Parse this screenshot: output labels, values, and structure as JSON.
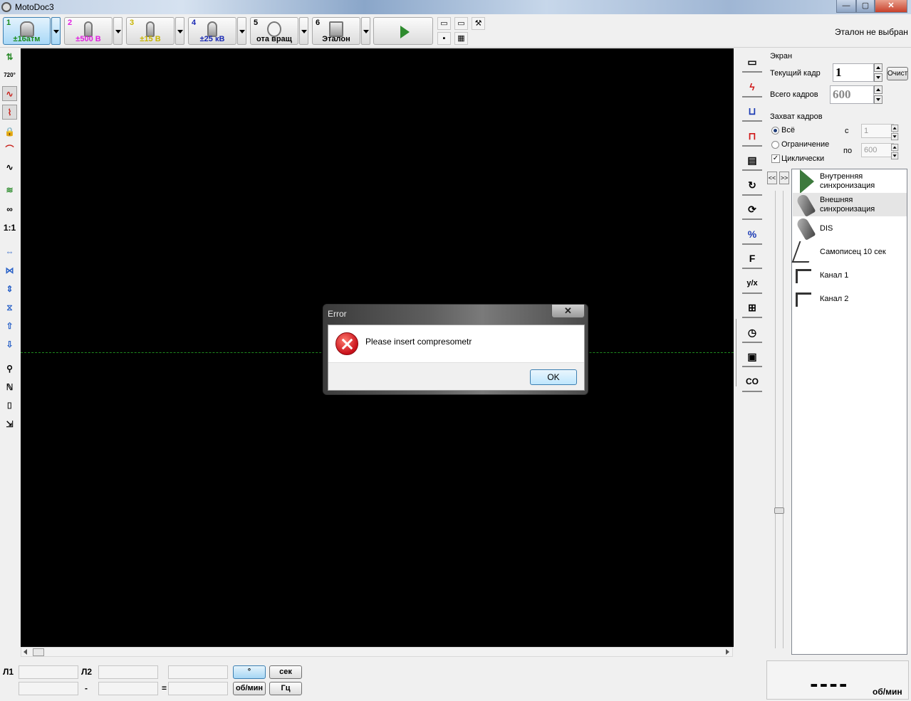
{
  "window": {
    "title": "MotoDoc3",
    "min": "—",
    "max": "▢",
    "close": "✕"
  },
  "toolbar": {
    "channels": [
      {
        "num": "1",
        "value": "±16атм",
        "num_color": "#1a8a1a",
        "value_color": "#1a8a1a"
      },
      {
        "num": "2",
        "value": "±500 В",
        "num_color": "#e020e0",
        "value_color": "#e020e0"
      },
      {
        "num": "3",
        "value": "±15 В",
        "num_color": "#c8b400",
        "value_color": "#c8b400"
      },
      {
        "num": "4",
        "value": "±25 кВ",
        "num_color": "#1a2ab4",
        "value_color": "#1a2ab4"
      },
      {
        "num": "5",
        "value": "ота вращ",
        "num_color": "#000000",
        "value_color": "#000000"
      },
      {
        "num": "6",
        "value": "Эталон",
        "num_color": "#000000",
        "value_color": "#000000"
      }
    ],
    "etalon_status": "Эталон не выбран",
    "small_icons": [
      "open-folder-icon",
      "open-file-icon",
      "wrench-icon",
      "save-icon",
      "export-icon"
    ]
  },
  "left_tools": [
    {
      "icon": "channels-icon",
      "glyph": "⇅"
    },
    {
      "icon": "720-icon",
      "glyph": "720°"
    },
    {
      "icon": "waveform-icon",
      "glyph": "∿"
    },
    {
      "icon": "trigger-icon",
      "glyph": "⌇"
    },
    {
      "icon": "lock-icon",
      "glyph": "🔒"
    },
    {
      "icon": "curve-icon",
      "glyph": "⌒"
    },
    {
      "icon": "sine-icon",
      "glyph": "∿"
    },
    {
      "icon": "multi-wave-icon",
      "glyph": "≋"
    },
    {
      "icon": "overlay-icon",
      "glyph": "∞"
    },
    {
      "icon": "scale-1-1-icon",
      "glyph": "1:1"
    },
    {
      "icon": "stretch-horizontal-icon",
      "glyph": "⇔"
    },
    {
      "icon": "shrink-horizontal-icon",
      "glyph": "⋈"
    },
    {
      "icon": "stretch-vertical-icon",
      "glyph": "⇕"
    },
    {
      "icon": "shrink-vertical-icon",
      "glyph": "⧖"
    },
    {
      "icon": "move-up-icon",
      "glyph": "⇧"
    },
    {
      "icon": "move-down-icon",
      "glyph": "⇩"
    },
    {
      "icon": "zoom-icon",
      "glyph": "⚲"
    },
    {
      "icon": "measure-icon",
      "glyph": "ℕ"
    },
    {
      "icon": "camera-icon",
      "glyph": "⌷"
    },
    {
      "icon": "export-icon",
      "glyph": "⇲"
    }
  ],
  "right_icons": [
    {
      "icon": "monitor-icon",
      "glyph": "▭"
    },
    {
      "icon": "spark-icon",
      "glyph": "ϟ"
    },
    {
      "icon": "pulse-blue-icon",
      "glyph": "⊔"
    },
    {
      "icon": "pulse-red-icon",
      "glyph": "⊓"
    },
    {
      "icon": "device-icon",
      "glyph": "▤"
    },
    {
      "icon": "rotation-icon",
      "glyph": "↻"
    },
    {
      "icon": "rotation-gear-icon",
      "glyph": "⟳"
    },
    {
      "icon": "percent-icon",
      "glyph": "%"
    },
    {
      "icon": "f-icon",
      "glyph": "F"
    },
    {
      "icon": "y-over-x-icon",
      "glyph": "y/x"
    },
    {
      "icon": "sensor-icon",
      "glyph": "⊞"
    },
    {
      "icon": "clock-icon",
      "glyph": "◷"
    },
    {
      "icon": "meter-icon",
      "glyph": "▣"
    },
    {
      "icon": "co-icon",
      "glyph": "CO"
    }
  ],
  "screen": {
    "group_title": "Экран",
    "current_frame_label": "Текущий кадр",
    "current_frame": "1",
    "total_frames_label": "Всего кадров",
    "total_frames": "600",
    "clear_label": "Очист"
  },
  "capture": {
    "group_title": "Захват кадров",
    "all_label": "Всё",
    "limit_label": "Ограничение",
    "cyclic_label": "Циклически",
    "from_label": "с",
    "from_value": "1",
    "to_label": "по",
    "to_value": "600",
    "nav_prev": "<<",
    "nav_next": ">>"
  },
  "sync_list": [
    {
      "label": "Внутренняя синхронизация",
      "icon": "play-sync-icon",
      "selected": false
    },
    {
      "label": "Внешняя синхронизация",
      "icon": "probe-icon",
      "selected": true
    },
    {
      "label": "DIS",
      "icon": "dis-probe-icon",
      "selected": false
    },
    {
      "label": "Самописец 10 сек",
      "icon": "recorder-icon",
      "selected": false
    },
    {
      "label": "Канал 1",
      "icon": "channel-1-icon",
      "selected": false
    },
    {
      "label": "Канал 2",
      "icon": "channel-2-icon",
      "selected": false
    }
  ],
  "bottom": {
    "l1": "Л1",
    "l2": "Л2",
    "minus": "-",
    "equals": "=",
    "deg_btn": "°",
    "sec_btn": "сек",
    "rpm_btn": "об/мин",
    "hz_btn": "Гц",
    "rpm_display": "----",
    "rpm_unit": "об/мин"
  },
  "dialog": {
    "title": "Error",
    "message": "Please insert compresometr",
    "ok": "OK",
    "close": "✕"
  }
}
